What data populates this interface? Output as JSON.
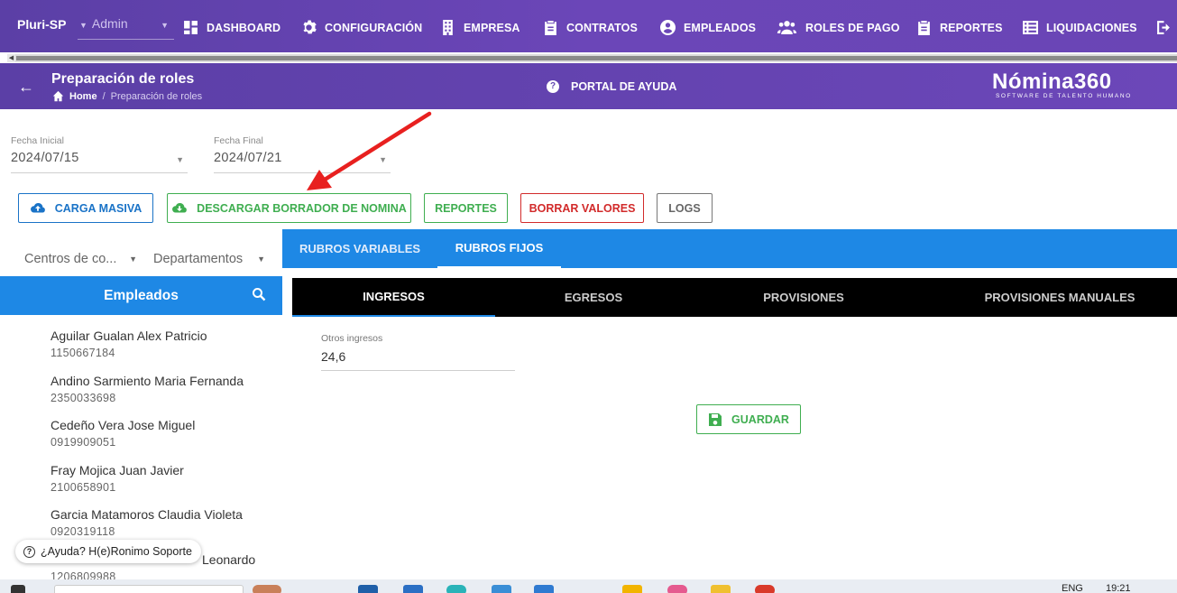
{
  "topnav": {
    "org": "Pluri-SP",
    "role": "Admin",
    "items": [
      {
        "label": "DASHBOARD",
        "icon": "dashboard-icon"
      },
      {
        "label": "CONFIGURACIÓN",
        "icon": "gear-icon"
      },
      {
        "label": "EMPRESA",
        "icon": "building-icon"
      },
      {
        "label": "CONTRATOS",
        "icon": "clipboard-icon"
      },
      {
        "label": "EMPLEADOS",
        "icon": "user-circle-icon"
      },
      {
        "label": "ROLES DE PAGO",
        "icon": "users-icon"
      },
      {
        "label": "REPORTES",
        "icon": "clipboard-list-icon"
      },
      {
        "label": "LIQUIDACIONES",
        "icon": "list-icon"
      }
    ]
  },
  "header": {
    "title": "Preparación de roles",
    "breadcrumb_home": "Home",
    "breadcrumb_current": "Preparación de roles",
    "help_label": "PORTAL DE AYUDA",
    "brand_name": "Nómina360",
    "brand_tagline": "SOFTWARE DE TALENTO HUMANO"
  },
  "dates": {
    "start_label": "Fecha Inicial",
    "start_value": "2024/07/15",
    "end_label": "Fecha Final",
    "end_value": "2024/07/21"
  },
  "actions": {
    "bulk_upload": "CARGA MASIVA",
    "download_draft": "DESCARGAR BORRADOR DE NOMINA",
    "reports": "REPORTES",
    "clear_values": "BORRAR VALORES",
    "logs": "LOGS"
  },
  "filters": {
    "cost_centers": "Centros de co...",
    "departments": "Departamentos"
  },
  "employees": {
    "title": "Empleados",
    "list": [
      {
        "name": "Aguilar Gualan Alex Patricio",
        "id": "1150667184"
      },
      {
        "name": "Andino Sarmiento Maria Fernanda",
        "id": "2350033698"
      },
      {
        "name": "Cedeño Vera Jose Miguel",
        "id": "0919909051"
      },
      {
        "name": "Fray Mojica Juan Javier",
        "id": "2100658901"
      },
      {
        "name": "Garcia Matamoros Claudia Violeta",
        "id": "0920319118"
      },
      {
        "name": "Leonardo",
        "id": "1206809988"
      }
    ]
  },
  "help_chat": "¿Ayuda? H(e)Ronimo Soporte",
  "tabs_primary": [
    "RUBROS VARIABLES",
    "RUBROS FIJOS"
  ],
  "tabs_secondary": [
    "INGRESOS",
    "EGRESOS",
    "PROVISIONES",
    "PROVISIONES MANUALES"
  ],
  "form": {
    "field_label": "Otros ingresos",
    "field_value": "24,6",
    "save_label": "GUARDAR"
  },
  "taskbar": {
    "lang": "ENG",
    "time": "19:21"
  },
  "colors": {
    "brand_purple": "#6546b3",
    "accent_blue": "#1e88e5",
    "success_green": "#3fae50",
    "danger_red": "#d22b2b",
    "annotation_red": "#e8201f"
  }
}
